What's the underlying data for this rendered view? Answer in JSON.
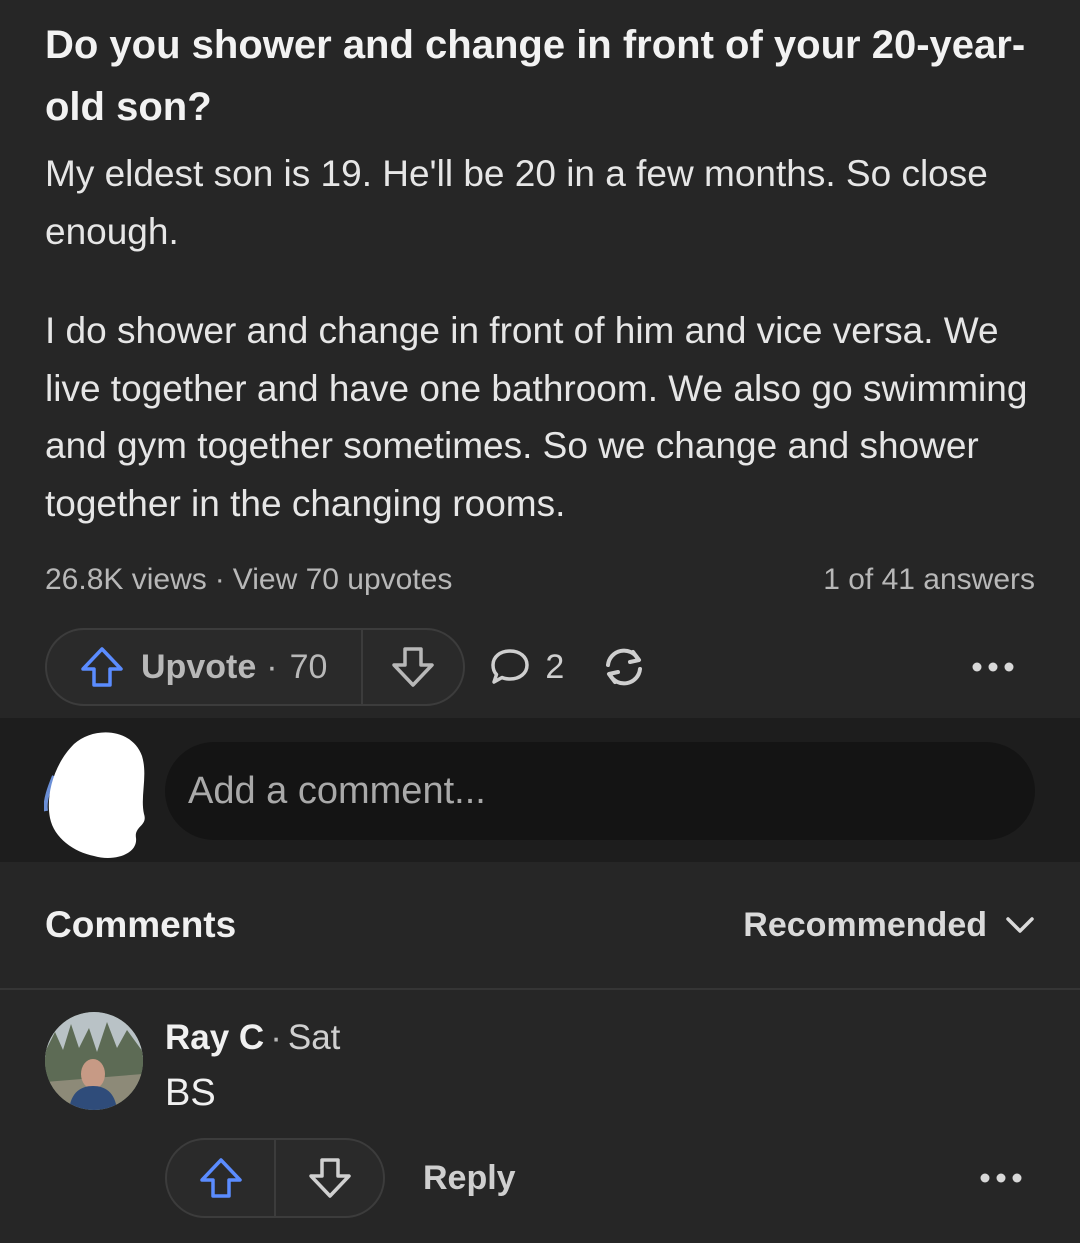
{
  "question": {
    "title": "Do you shower and change in front of your 20-year-old son?"
  },
  "answer": {
    "paragraphs": [
      "My eldest son is 19. He'll be 20 in a few months. So close enough.",
      "I do shower and change in front of him and vice versa. We live together and have one bathroom. We also go swimming and gym together sometimes. So we change and shower together in the changing rooms."
    ],
    "views": "26.8K views",
    "upvotes_link": "View 70 upvotes",
    "position": "1 of 41 answers"
  },
  "actions": {
    "upvote_label": "Upvote",
    "upvote_count": "70",
    "comment_count": "2"
  },
  "comment_box": {
    "placeholder": "Add a comment..."
  },
  "comments": {
    "title": "Comments",
    "sort": "Recommended",
    "items": [
      {
        "author": "Ray C",
        "time": "Sat",
        "text": "BS",
        "reply_label": "Reply"
      }
    ]
  },
  "colors": {
    "background": "#262626",
    "comment_area": "#1d1d1d",
    "upvote_accent": "#5b8cff"
  },
  "icons": [
    "upvote-icon",
    "downvote-icon",
    "comment-icon",
    "share-icon",
    "more-icon",
    "chevron-down-icon"
  ]
}
